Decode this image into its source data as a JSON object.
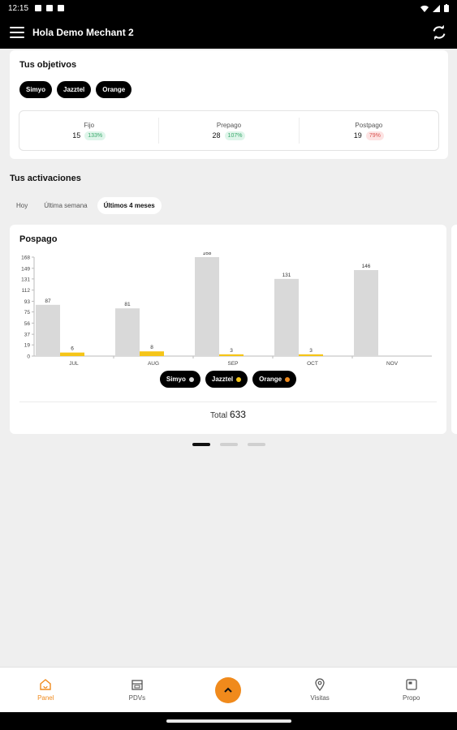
{
  "status_bar": {
    "time": "12:15"
  },
  "app_bar": {
    "title": "Hola Demo Mechant 2"
  },
  "objectives": {
    "title": "Tus objetivos",
    "chips": [
      "Simyo",
      "Jazztel",
      "Orange"
    ],
    "stats": [
      {
        "label": "Fijo",
        "value": "15",
        "badge": "133%",
        "tone": "green"
      },
      {
        "label": "Prepago",
        "value": "28",
        "badge": "107%",
        "tone": "green"
      },
      {
        "label": "Postpago",
        "value": "19",
        "badge": "79%",
        "tone": "red"
      }
    ]
  },
  "activations": {
    "title": "Tus activaciones",
    "tabs": [
      "Hoy",
      "Última semana",
      "Últimos 4 meses"
    ],
    "active_tab": 2
  },
  "chart_card": {
    "title": "Pospago",
    "total_label": "Total",
    "total_value": "633"
  },
  "chart_data": {
    "type": "bar",
    "categories": [
      "JUL",
      "AUG",
      "SEP",
      "OCT",
      "NOV"
    ],
    "series": [
      {
        "name": "Simyo",
        "values": [
          87,
          81,
          168,
          131,
          146
        ],
        "color": "#d9d9d9"
      },
      {
        "name": "Jazztel",
        "values": [
          6,
          8,
          3,
          3,
          0
        ],
        "color": "#f5c518"
      },
      {
        "name": "Orange",
        "values": [
          0,
          0,
          0,
          0,
          0
        ],
        "color": "#f08a1c"
      }
    ],
    "yticks": [
      0,
      19,
      37,
      56,
      75,
      93,
      112,
      131,
      149,
      168
    ],
    "ylim": [
      0,
      168
    ],
    "legend": [
      "Simyo",
      "Jazztel",
      "Orange"
    ],
    "legend_dot_colors": [
      "#d9d9d9",
      "#f5c518",
      "#f08a1c"
    ],
    "legend_position": "bottom",
    "grid": false
  },
  "pager": {
    "count": 3,
    "active": 0
  },
  "bottom_nav": {
    "items": [
      {
        "label": "Panel",
        "icon": "home-icon",
        "active": true
      },
      {
        "label": "PDVs",
        "icon": "store-icon",
        "active": false
      },
      {
        "label": "",
        "icon": "chevron-up-icon",
        "fab": true
      },
      {
        "label": "Visitas",
        "icon": "location-pin-icon",
        "active": false
      },
      {
        "label": "Propo",
        "icon": "image-icon",
        "active": false
      }
    ]
  },
  "colors": {
    "accent": "#f08a1c",
    "appbar": "#000000"
  }
}
